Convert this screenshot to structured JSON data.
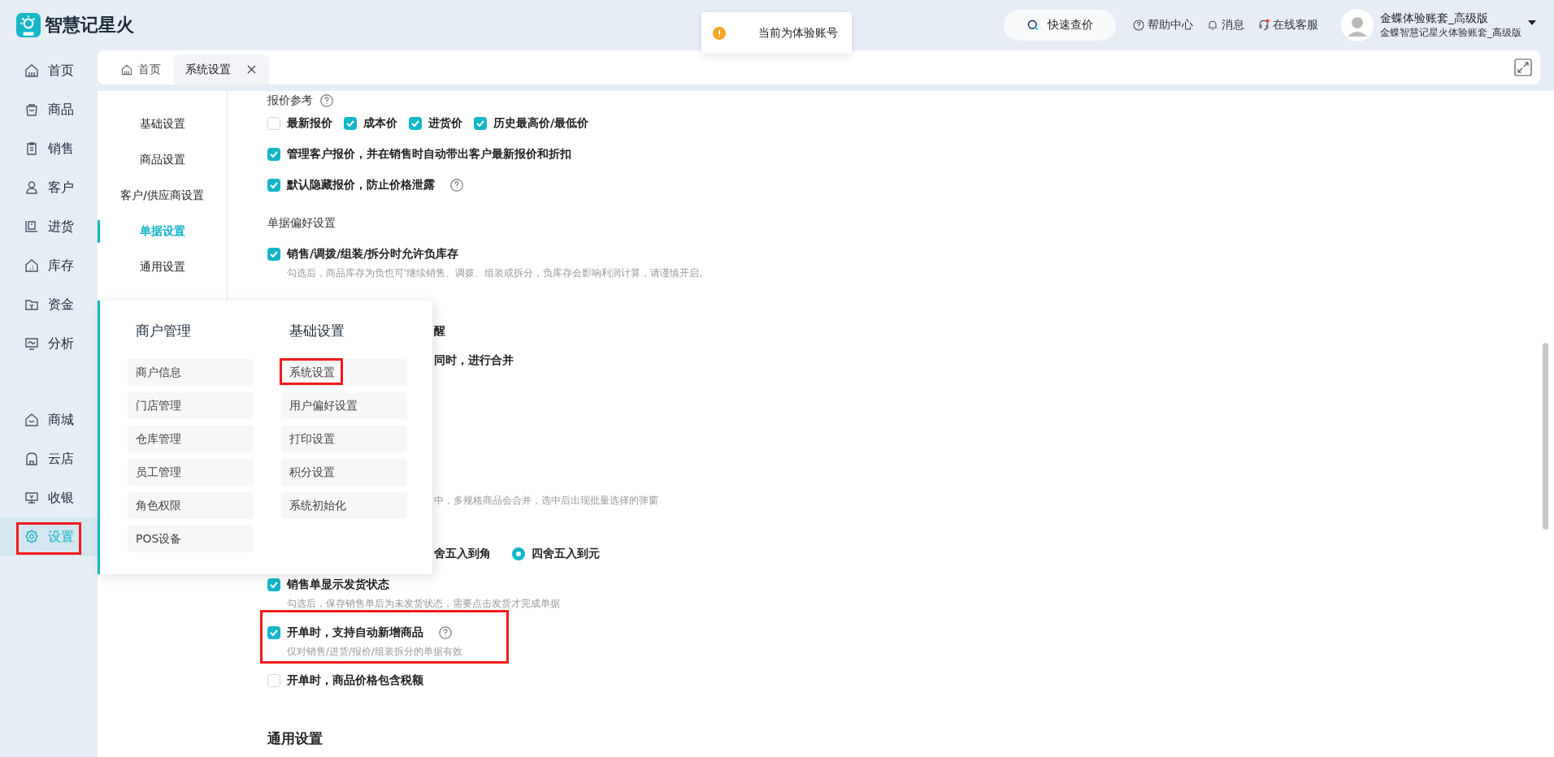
{
  "app": {
    "name": "智慧记星火"
  },
  "toast": {
    "text": "当前为体验账号"
  },
  "header": {
    "search_button": "快速查价",
    "links": [
      "帮助中心",
      "消息",
      "在线客服"
    ],
    "account": {
      "name": "金蝶体验账套_高级版",
      "subtitle": "金蝶智慧记星火体验账套_高级版"
    }
  },
  "sidebar": {
    "items": [
      {
        "label": "首页",
        "selected": false,
        "highlighted": false
      },
      {
        "label": "商品",
        "selected": false,
        "highlighted": false
      },
      {
        "label": "销售",
        "selected": false,
        "highlighted": false
      },
      {
        "label": "客户",
        "selected": false,
        "highlighted": false
      },
      {
        "label": "进货",
        "selected": false,
        "highlighted": false
      },
      {
        "label": "库存",
        "selected": false,
        "highlighted": false
      },
      {
        "label": "资金",
        "selected": false,
        "highlighted": false
      },
      {
        "label": "分析",
        "selected": false,
        "highlighted": false
      }
    ],
    "bottom_items": [
      {
        "label": "商城",
        "selected": false,
        "highlighted": false
      },
      {
        "label": "云店",
        "selected": false,
        "highlighted": false
      },
      {
        "label": "收银",
        "selected": false,
        "highlighted": false
      },
      {
        "label": "设置",
        "selected": true,
        "highlighted": true
      }
    ]
  },
  "tabs": [
    {
      "label": "首页",
      "selected": false,
      "closable": false
    },
    {
      "label": "系统设置",
      "selected": true,
      "closable": true
    }
  ],
  "settings_nav": [
    {
      "label": "基础设置",
      "selected": false
    },
    {
      "label": "商品设置",
      "selected": false
    },
    {
      "label": "客户/供应商设置",
      "selected": false
    },
    {
      "label": "单据设置",
      "selected": true
    },
    {
      "label": "通用设置",
      "selected": false
    }
  ],
  "rows": [
    {
      "kind": "label",
      "text": "报价参考",
      "help": true
    },
    {
      "kind": "check_group",
      "options": [
        {
          "label": "最新报价",
          "checked": false
        },
        {
          "label": "成本价",
          "checked": true
        },
        {
          "label": "进货价",
          "checked": true
        },
        {
          "label": "历史最高价/最低价",
          "checked": true
        }
      ]
    },
    {
      "kind": "check",
      "label": "管理客户报价，并在销售时自动带出客户最新报价和折扣",
      "checked": true,
      "help": false,
      "highlighted": false
    },
    {
      "kind": "check",
      "label": "默认隐藏报价，防止价格泄露",
      "checked": true,
      "help": true,
      "highlighted": false
    },
    {
      "kind": "label",
      "text": "单据偏好设置",
      "help": false
    },
    {
      "kind": "check",
      "label": "销售/调拨/组装/拆分时允许负库存",
      "checked": true,
      "help": false,
      "highlighted": false,
      "hint": "勾选后，商品库存为负也可'继续销售、调拨、组装或拆分，负库存会影响利润计算，请谨慎开启。"
    },
    {
      "kind": "fragment",
      "text": "醒"
    },
    {
      "kind": "fragment",
      "text": "同时，进行合并"
    },
    {
      "kind": "fragment_hint",
      "text": "中，多规格商品会合并，选中后出现批量选择的弹窗"
    },
    {
      "kind": "radio",
      "cut_text": "舍五入到角",
      "options": [
        {
          "label": "四舍五入到元",
          "selected": true
        }
      ]
    },
    {
      "kind": "check",
      "label": "销售单显示发货状态",
      "checked": true,
      "help": false,
      "highlighted": false,
      "hint": "勾选后，保存销售单后为未发货状态，需要点击发货才完成单据"
    },
    {
      "kind": "check",
      "label": "开单时，支持自动新增商品",
      "checked": true,
      "help": true,
      "highlighted": true,
      "hint": "仅对销售/进货/报价/组装拆分的单据有效"
    },
    {
      "kind": "check",
      "label": "开单时，商品价格包含税额",
      "checked": false,
      "help": false,
      "highlighted": false
    },
    {
      "kind": "title",
      "text": "通用设置"
    }
  ],
  "menu_popup": {
    "columns": [
      {
        "title": "商户管理",
        "items": [
          {
            "label": "商户信息",
            "highlighted": false
          },
          {
            "label": "门店管理",
            "highlighted": false
          },
          {
            "label": "仓库管理",
            "highlighted": false
          },
          {
            "label": "员工管理",
            "highlighted": false
          },
          {
            "label": "角色权限",
            "highlighted": false
          },
          {
            "label": "POS设备",
            "highlighted": false
          }
        ]
      },
      {
        "title": "基础设置",
        "items": [
          {
            "label": "系统设置",
            "highlighted": true
          },
          {
            "label": "用户偏好设置",
            "highlighted": false
          },
          {
            "label": "打印设置",
            "highlighted": false
          },
          {
            "label": "积分设置",
            "highlighted": false
          },
          {
            "label": "系统初始化",
            "highlighted": false
          }
        ]
      }
    ]
  }
}
